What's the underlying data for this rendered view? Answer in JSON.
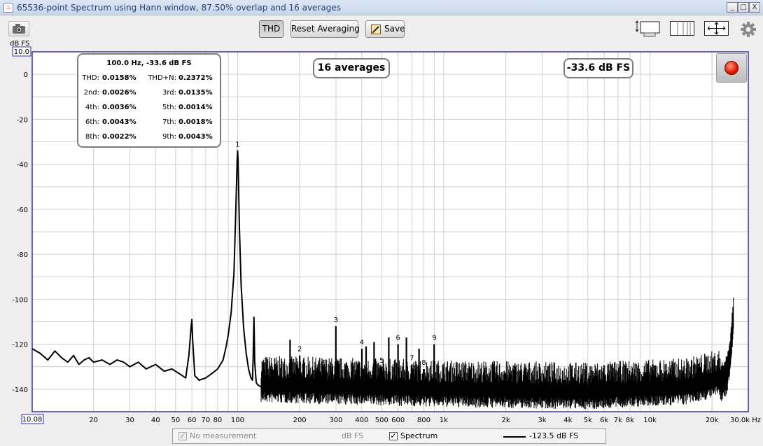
{
  "window": {
    "title": "65536-point Spectrum using Hann window, 87.50% overlap and 16 averages",
    "title_icon": "java-icon",
    "controls": [
      "_",
      "□",
      "X"
    ]
  },
  "toolbar": {
    "thd_label": "THD",
    "reset_label": "Reset Averaging",
    "save_label": "Save"
  },
  "thd_panel": {
    "header": "100.0 Hz, -33.6 dB FS",
    "rows": [
      [
        {
          "label": "THD:",
          "value": "0.0158%"
        },
        {
          "label": "THD+N:",
          "value": "0.2372%"
        }
      ],
      [
        {
          "label": "2nd:",
          "value": "0.0026%"
        },
        {
          "label": "3rd:",
          "value": "0.0135%"
        }
      ],
      [
        {
          "label": "4th:",
          "value": "0.0036%"
        },
        {
          "label": "5th:",
          "value": "0.0014%"
        }
      ],
      [
        {
          "label": "6th:",
          "value": "0.0043%"
        },
        {
          "label": "7th:",
          "value": "0.0018%"
        }
      ],
      [
        {
          "label": "8th:",
          "value": "0.0022%"
        },
        {
          "label": "9th:",
          "value": "0.0043%"
        }
      ]
    ]
  },
  "averages_label": "16 averages",
  "level_label": "-33.6 dB FS",
  "legend": {
    "no_measurement": "No measurement",
    "unit": "dB FS",
    "spectrum": "Spectrum",
    "trace_value": "-123.5 dB FS"
  },
  "colors": {
    "trace": "#000000",
    "marker": "#1a2a9a",
    "grid": "#cfcfcf",
    "axis_border": "#3333aa"
  },
  "chart_data": {
    "type": "line",
    "yunit": "dB FS",
    "xunit": "Hz",
    "xscale": "log",
    "xlim": [
      10.08,
      30000
    ],
    "ylim": [
      -150,
      10
    ],
    "ymax_label": "10.0",
    "xmin_label": "10.08",
    "xmax_label": "30.0k Hz",
    "y_ticks": [
      0,
      -20,
      -40,
      -60,
      -80,
      -100,
      -120,
      -140
    ],
    "x_ticks": [
      {
        "v": 20,
        "label": "20"
      },
      {
        "v": 30,
        "label": "30"
      },
      {
        "v": 40,
        "label": "40"
      },
      {
        "v": 50,
        "label": "50"
      },
      {
        "v": 60,
        "label": "60"
      },
      {
        "v": 70,
        "label": "70"
      },
      {
        "v": 80,
        "label": "80"
      },
      {
        "v": 100,
        "label": "100"
      },
      {
        "v": 200,
        "label": "200"
      },
      {
        "v": 300,
        "label": "300"
      },
      {
        "v": 400,
        "label": "400"
      },
      {
        "v": 500,
        "label": "500"
      },
      {
        "v": 600,
        "label": "600"
      },
      {
        "v": 800,
        "label": "800"
      },
      {
        "v": 1000,
        "label": "1k"
      },
      {
        "v": 2000,
        "label": "2k"
      },
      {
        "v": 3000,
        "label": "3k"
      },
      {
        "v": 4000,
        "label": "4k"
      },
      {
        "v": 5000,
        "label": "5k"
      },
      {
        "v": 6000,
        "label": "6k"
      },
      {
        "v": 7000,
        "label": "7k"
      },
      {
        "v": 8000,
        "label": "8k"
      },
      {
        "v": 10000,
        "label": "10k"
      },
      {
        "v": 20000,
        "label": "20k"
      }
    ],
    "harmonics": [
      {
        "n": "1",
        "f": 100,
        "db": -34
      },
      {
        "n": "2",
        "f": 200,
        "db": -125
      },
      {
        "n": "3",
        "f": 300,
        "db": -112
      },
      {
        "n": "4",
        "f": 400,
        "db": -122
      },
      {
        "n": "5",
        "f": 500,
        "db": -130
      },
      {
        "n": "6",
        "f": 600,
        "db": -120
      },
      {
        "n": "7",
        "f": 700,
        "db": -129
      },
      {
        "n": "8",
        "f": 800,
        "db": -131
      },
      {
        "n": "9",
        "f": 900,
        "db": -120
      }
    ],
    "series": [
      {
        "x": [
          10.08,
          11,
          12,
          13,
          14,
          15,
          16,
          17,
          18,
          19,
          20,
          22,
          24,
          26,
          28,
          30,
          33,
          36,
          40,
          44,
          48,
          52,
          56,
          58,
          59.5,
          60,
          60.5,
          62,
          65,
          70,
          75,
          80,
          85,
          88,
          90,
          93,
          96,
          98,
          99.5,
          100,
          100.5,
          102,
          104,
          107,
          110,
          113,
          116,
          118,
          119,
          120,
          121,
          123,
          125,
          130
        ],
        "y": [
          -122,
          -124,
          -127,
          -123,
          -126,
          -128,
          -125,
          -129,
          -127,
          -126,
          -128,
          -127,
          -129,
          -127,
          -128,
          -130,
          -128,
          -131,
          -129,
          -132,
          -131,
          -133,
          -135,
          -125,
          -112,
          -109,
          -118,
          -134,
          -136,
          -135,
          -133,
          -131,
          -127,
          -121,
          -116,
          -106,
          -88,
          -60,
          -38,
          -34,
          -38,
          -68,
          -94,
          -113,
          -124,
          -131,
          -135,
          -136,
          -125,
          -108,
          -128,
          -137,
          -138,
          -139
        ]
      }
    ],
    "noise_floor": [
      {
        "f": 130,
        "db": -139
      },
      {
        "f": 1000,
        "db": -141
      },
      {
        "f": 5000,
        "db": -142
      },
      {
        "f": 15000,
        "db": -140
      },
      {
        "f": 22000,
        "db": -136
      }
    ],
    "hf_rise": [
      {
        "f": 22000,
        "db": -136
      },
      {
        "f": 23500,
        "db": -132
      },
      {
        "f": 24500,
        "db": -124
      },
      {
        "f": 25000,
        "db": -113
      },
      {
        "f": 25500,
        "db": -105
      }
    ]
  }
}
